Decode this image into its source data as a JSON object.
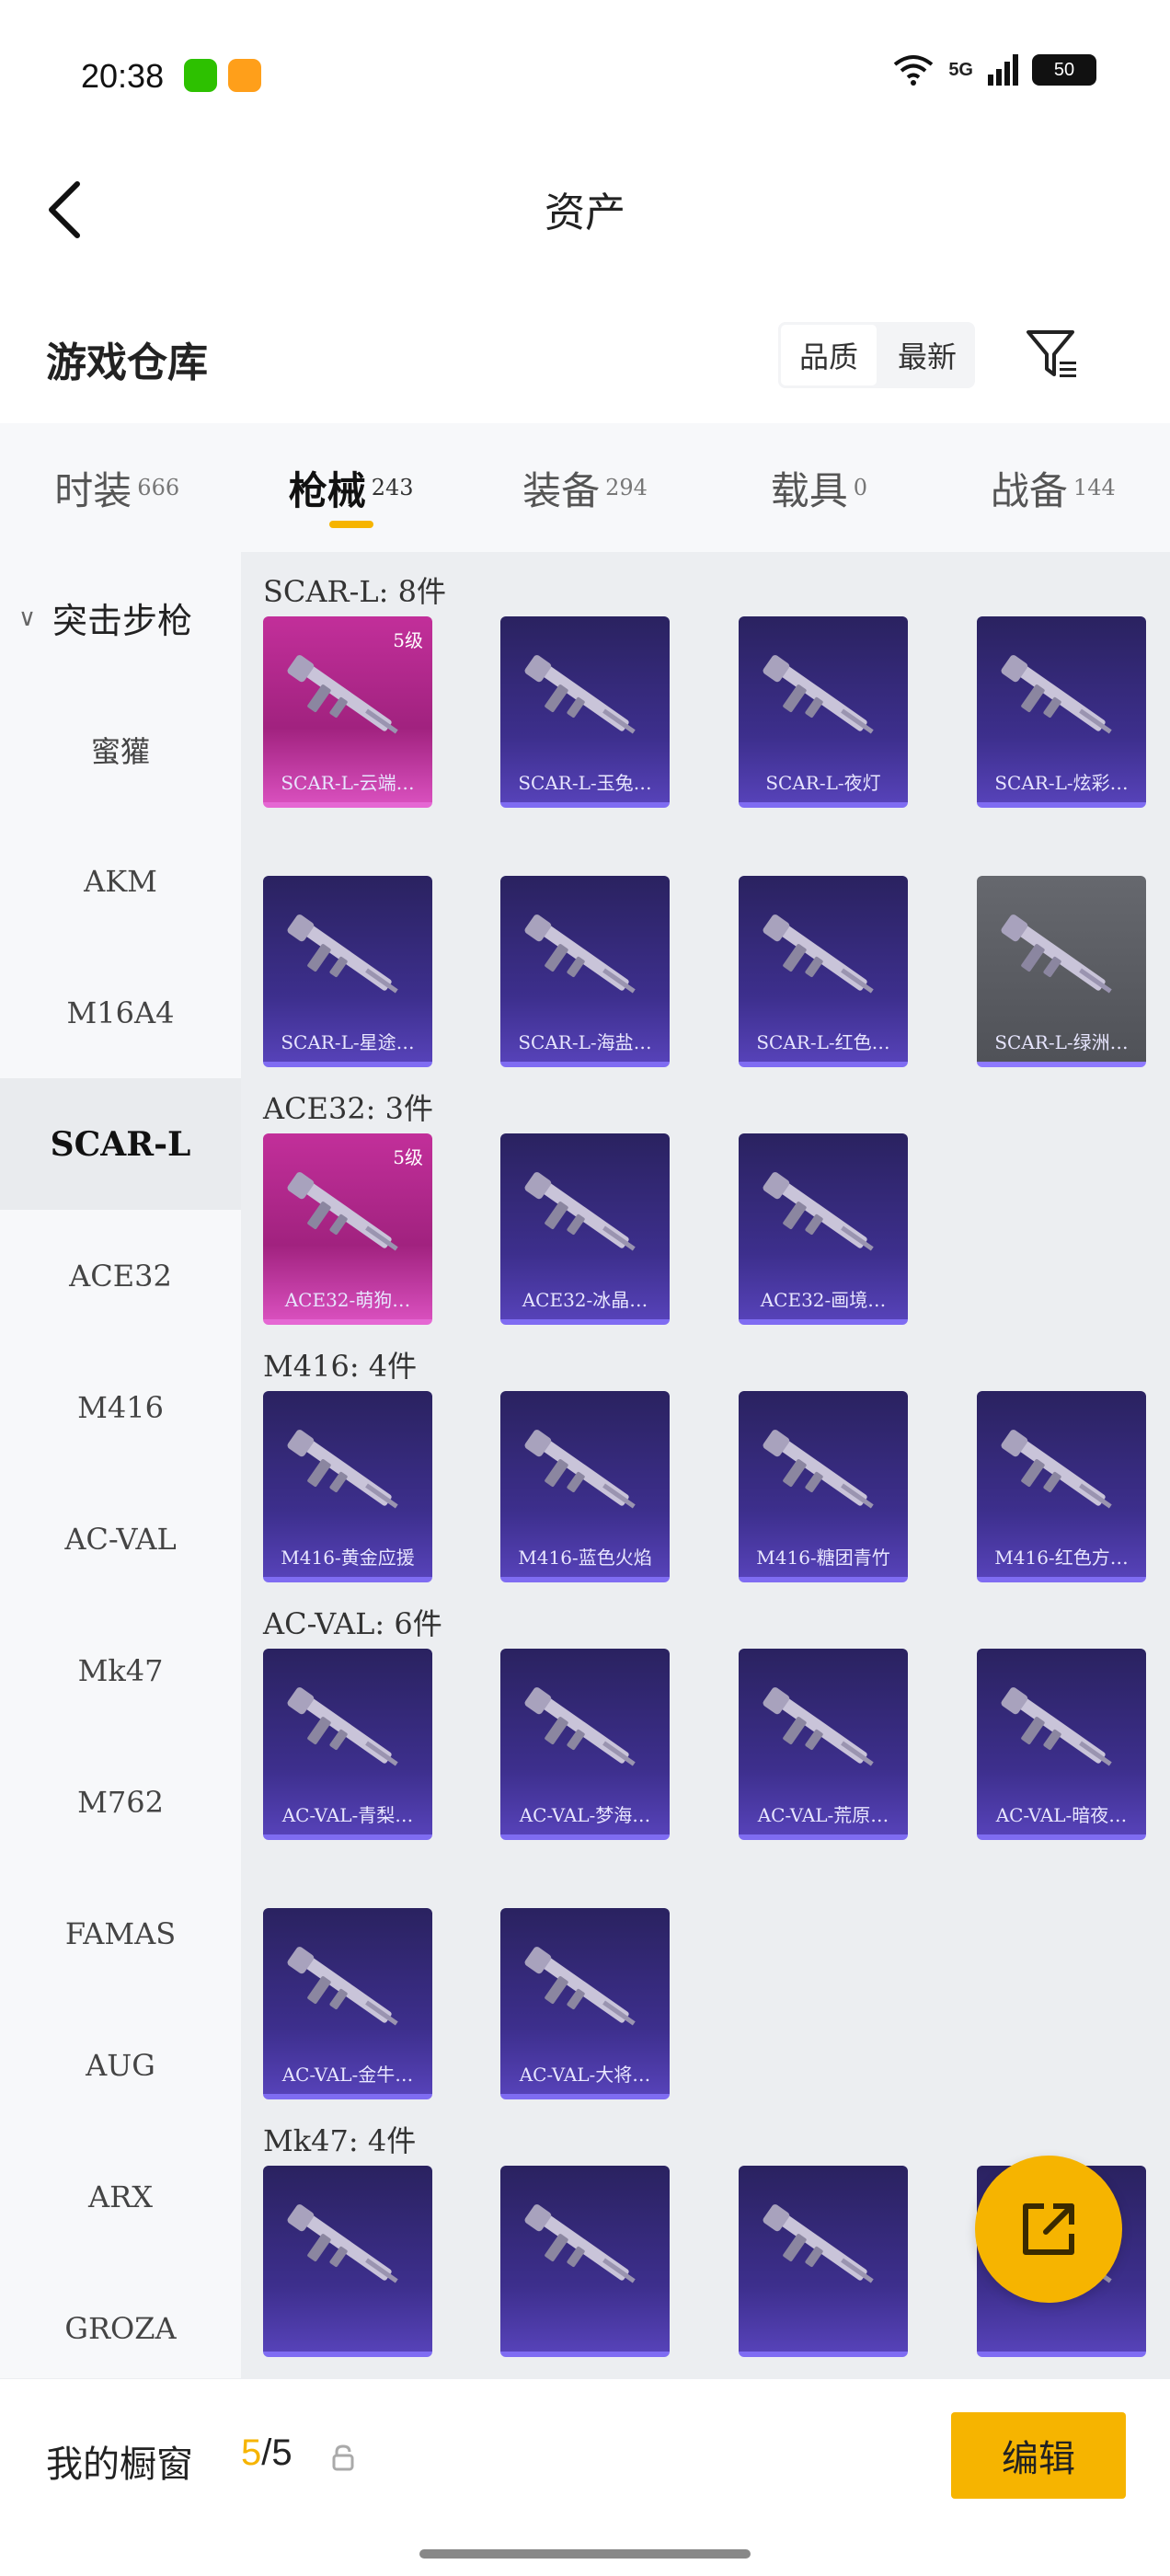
{
  "status_bar": {
    "time": "20:38",
    "network": "5G",
    "battery": "50"
  },
  "header": {
    "title": "资产"
  },
  "warehouse": {
    "title": "游戏仓库",
    "sort_options": [
      "品质",
      "最新"
    ],
    "active_sort": "品质"
  },
  "tabs": [
    {
      "label": "时装",
      "count": "666"
    },
    {
      "label": "枪械",
      "count": "243"
    },
    {
      "label": "装备",
      "count": "294"
    },
    {
      "label": "载具",
      "count": "0"
    },
    {
      "label": "战备",
      "count": "144"
    }
  ],
  "sidebar": {
    "group_label": "突击步枪",
    "items": [
      "蜜獾",
      "AKM",
      "M16A4",
      "SCAR-L",
      "ACE32",
      "M416",
      "AC-VAL",
      "Mk47",
      "M762",
      "FAMAS",
      "AUG",
      "ARX",
      "GROZA"
    ],
    "active": "SCAR-L"
  },
  "sections": [
    {
      "title": "SCAR-L: 8件",
      "items": [
        {
          "name": "SCAR-L-云端…",
          "level": "5级",
          "rarity": "legendary"
        },
        {
          "name": "SCAR-L-玉兔…",
          "rarity": "epic"
        },
        {
          "name": "SCAR-L-夜灯",
          "rarity": "epic"
        },
        {
          "name": "SCAR-L-炫彩…",
          "rarity": "epic"
        },
        {
          "name": "SCAR-L-星途…",
          "rarity": "epic"
        },
        {
          "name": "SCAR-L-海盐…",
          "rarity": "epic"
        },
        {
          "name": "SCAR-L-红色…",
          "rarity": "epic"
        },
        {
          "name": "SCAR-L-绿洲…",
          "rarity": "basic"
        }
      ]
    },
    {
      "title": "ACE32: 3件",
      "items": [
        {
          "name": "ACE32-萌狗…",
          "level": "5级",
          "rarity": "legendary"
        },
        {
          "name": "ACE32-冰晶…",
          "rarity": "epic"
        },
        {
          "name": "ACE32-画境…",
          "rarity": "epic"
        }
      ]
    },
    {
      "title": "M416: 4件",
      "items": [
        {
          "name": "M416-黄金应援",
          "rarity": "epic"
        },
        {
          "name": "M416-蓝色火焰",
          "rarity": "epic"
        },
        {
          "name": "M416-糖团青竹",
          "rarity": "epic"
        },
        {
          "name": "M416-红色方…",
          "rarity": "epic"
        }
      ]
    },
    {
      "title": "AC-VAL: 6件",
      "items": [
        {
          "name": "AC-VAL-青梨…",
          "rarity": "epic"
        },
        {
          "name": "AC-VAL-梦海…",
          "rarity": "epic"
        },
        {
          "name": "AC-VAL-荒原…",
          "rarity": "epic"
        },
        {
          "name": "AC-VAL-暗夜…",
          "rarity": "epic"
        },
        {
          "name": "AC-VAL-金牛…",
          "rarity": "epic"
        },
        {
          "name": "AC-VAL-大将…",
          "rarity": "epic"
        }
      ]
    },
    {
      "title": "Mk47: 4件",
      "items": [
        {
          "name": "",
          "rarity": "epic"
        },
        {
          "name": "",
          "rarity": "epic"
        },
        {
          "name": "",
          "rarity": "epic"
        },
        {
          "name": "",
          "rarity": "epic"
        }
      ]
    }
  ],
  "bottom_bar": {
    "label": "我的橱窗",
    "count_current": "5",
    "count_total": "/5",
    "edit_label": "编辑"
  },
  "colors": {
    "accent": "#f6b400",
    "epic_bg": "#3d2f8d",
    "legendary_bg": "#c22f9a",
    "basic_bg": "#66686e"
  }
}
